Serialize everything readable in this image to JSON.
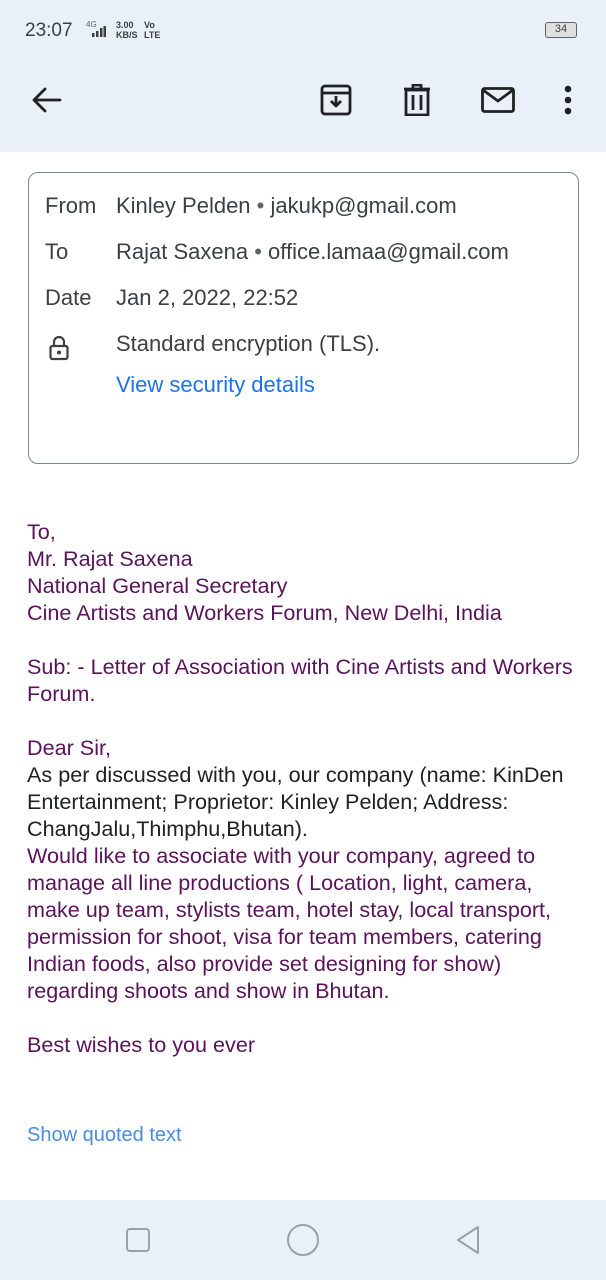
{
  "status_bar": {
    "time": "23:07",
    "network_type": "4G",
    "speed_value": "3.00",
    "speed_unit": "KB/S",
    "volte_top": "Vo",
    "volte_bottom": "LTE",
    "battery": "34"
  },
  "toolbar": {
    "back_icon": "arrow-left-icon",
    "archive_icon": "archive-icon",
    "delete_icon": "trash-icon",
    "mark_unread_icon": "mail-icon",
    "more_icon": "more-vert-icon"
  },
  "details": {
    "from_label": "From",
    "from_name": "Kinley Pelden",
    "from_email": "jakukp@gmail.com",
    "to_label": "To",
    "to_name": "Rajat Saxena",
    "to_email": "office.lamaa@gmail.com",
    "date_label": "Date",
    "date_value": "Jan 2, 2022, 22:52",
    "encryption": "Standard encryption (TLS).",
    "security_link": "View security details",
    "separator": "•"
  },
  "message": {
    "lines": {
      "l1": "To,",
      "l2": "Mr. Rajat Saxena",
      "l3": "National General Secretary",
      "l4": "Cine Artists and Workers Forum, New Delhi, India",
      "l5": "Sub: - Letter of Association with Cine Artists and Workers Forum.",
      "l6": "Dear Sir,",
      "l7": "As per discussed with you, our company (name: KinDen Entertainment; Proprietor: Kinley Pelden; Address: ChangJalu,Thimphu,Bhutan).",
      "l8": "Would like to associate with your company, agreed to manage all line productions ( Location, light, camera, make up team, stylists team, hotel stay, local transport, permission for shoot, visa for team members, catering Indian foods, also provide set designing for show) regarding shoots and show in Bhutan.",
      "l9": "Best wishes to you ever"
    },
    "show_quoted": "Show quoted text"
  },
  "nav": {
    "recents_icon": "square-icon",
    "home_icon": "circle-icon",
    "back_icon": "triangle-back-icon"
  }
}
